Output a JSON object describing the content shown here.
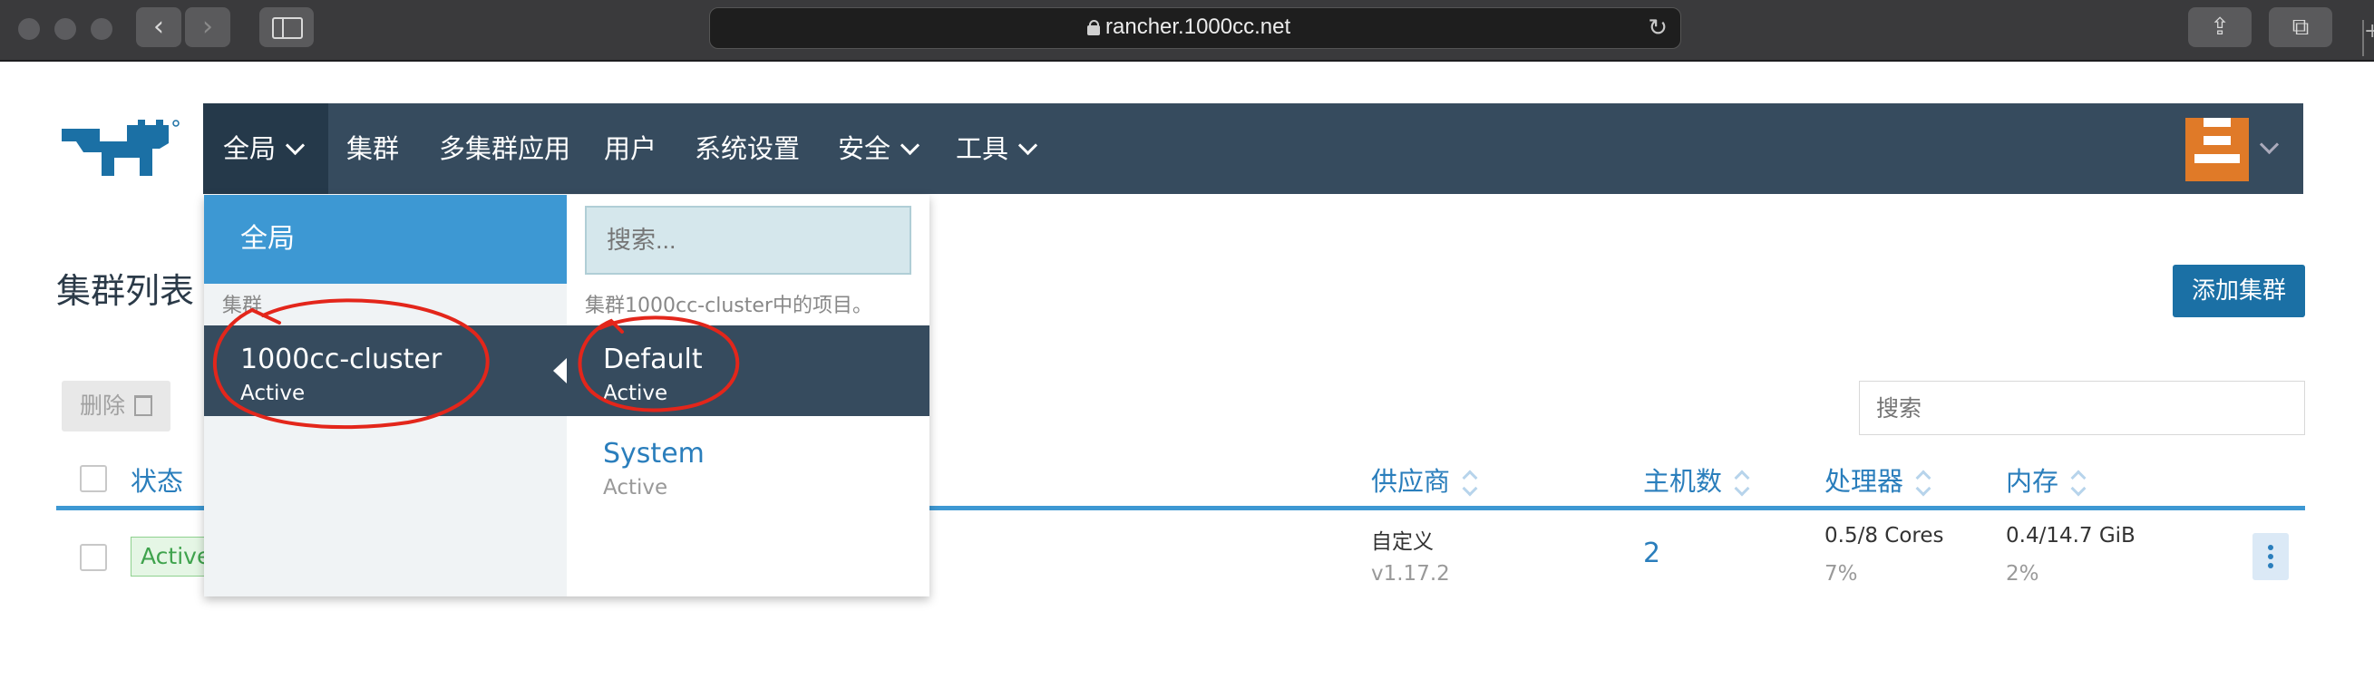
{
  "browser": {
    "url": "rancher.1000cc.net",
    "back_icon": "chevron-left-icon",
    "forward_icon": "chevron-right-icon",
    "reload_icon": "reload-icon",
    "share_icon": "share-icon",
    "tabs_icon": "tabs-icon"
  },
  "nav": {
    "items": [
      {
        "label": "全局"
      },
      {
        "label": "集群"
      },
      {
        "label": "多集群应用"
      },
      {
        "label": "用户"
      },
      {
        "label": "系统设置"
      },
      {
        "label": "安全"
      },
      {
        "label": "工具"
      }
    ]
  },
  "page": {
    "title": "集群列表",
    "add_cluster_label": "添加集群",
    "delete_label": "删除",
    "search_placeholder": "搜索"
  },
  "table": {
    "columns": {
      "status": "状态",
      "provider": "供应商",
      "hosts": "主机数",
      "cpu": "处理器",
      "memory": "内存"
    },
    "rows": [
      {
        "status": "Active",
        "provider": "自定义",
        "provider_version": "v1.17.2",
        "hosts": "2",
        "cpu": "0.5/8 Cores",
        "cpu_pct": "7%",
        "memory": "0.4/14.7 GiB",
        "memory_pct": "2%"
      }
    ]
  },
  "dropdown": {
    "global_label": "全局",
    "clusters_section": "集群",
    "cluster": {
      "name": "1000cc-cluster",
      "state": "Active"
    },
    "search_placeholder": "搜索...",
    "projects_section": "集群1000cc-cluster中的项目。",
    "projects": [
      {
        "name": "Default",
        "state": "Active"
      },
      {
        "name": "System",
        "state": "Active"
      }
    ]
  },
  "colors": {
    "nav_bg": "#364b5e",
    "accent": "#3d98d3",
    "primary_button": "#1b70a5",
    "annotation": "#e3261b"
  }
}
